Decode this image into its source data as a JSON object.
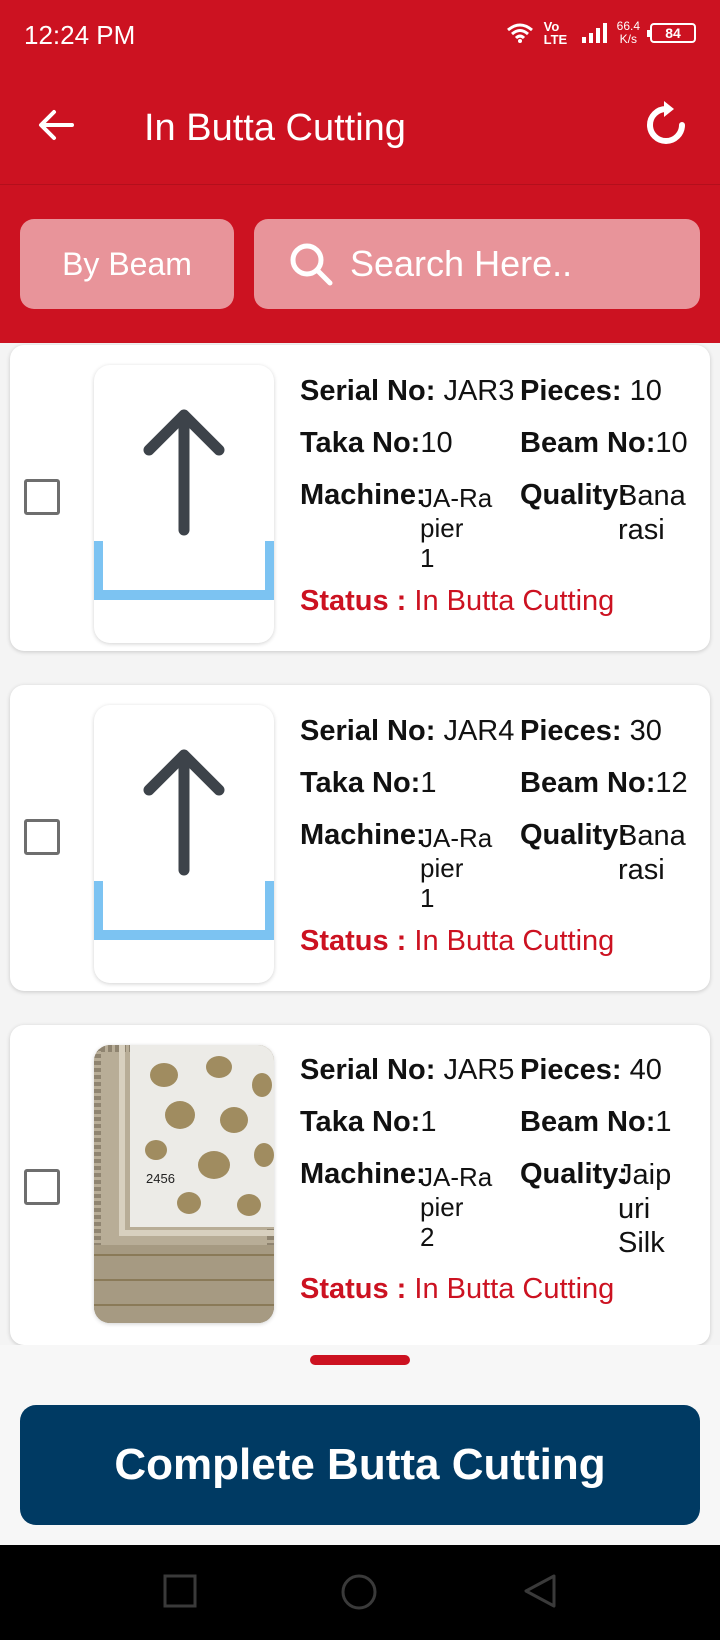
{
  "status_bar": {
    "time": "12:24 PM",
    "network_label": "Vo LTE",
    "speed": "66.4",
    "speed_unit": "K/s",
    "battery": "84"
  },
  "app_bar": {
    "title": "In Butta Cutting",
    "back_icon": "arrow-left-icon",
    "refresh_icon": "refresh-icon"
  },
  "filters": {
    "by_beam_label": "By Beam",
    "search_placeholder": "Search Here.."
  },
  "labels": {
    "serial_no": "Serial No:",
    "pieces": "Pieces:",
    "taka_no": "Taka No:",
    "beam_no": "Beam No:",
    "machine": "Machine:",
    "quality": "Quality:",
    "status": "Status :"
  },
  "items": [
    {
      "serial_no": "JAR3",
      "pieces": "10",
      "taka_no": "10",
      "beam_no": "10",
      "machine_lines": [
        "JA-Ra",
        "pier",
        "1"
      ],
      "quality_lines": [
        "Bana",
        "rasi"
      ],
      "status": "In Butta Cutting",
      "image": "upload-placeholder-icon"
    },
    {
      "serial_no": "JAR4",
      "pieces": "30",
      "taka_no": "1",
      "beam_no": "12",
      "machine_lines": [
        "JA-Ra",
        "pier",
        "1"
      ],
      "quality_lines": [
        "Bana",
        "rasi"
      ],
      "status": "In Butta Cutting",
      "image": "upload-placeholder-icon"
    },
    {
      "serial_no": "JAR5",
      "pieces": "40",
      "taka_no": "1",
      "beam_no": "1",
      "machine_lines": [
        "JA-Ra",
        "pier",
        "2"
      ],
      "quality_lines": [
        "Jaip",
        "uri",
        "Silk"
      ],
      "status": "In Butta Cutting",
      "image": "fabric-photo",
      "image_caption": "2456"
    }
  ],
  "complete_button_label": "Complete Butta Cutting",
  "colors": {
    "primary_red": "#cc1221",
    "button_navy": "#003a63",
    "upload_blue": "#7cc3f2",
    "arrow_dark": "#3d434a"
  }
}
